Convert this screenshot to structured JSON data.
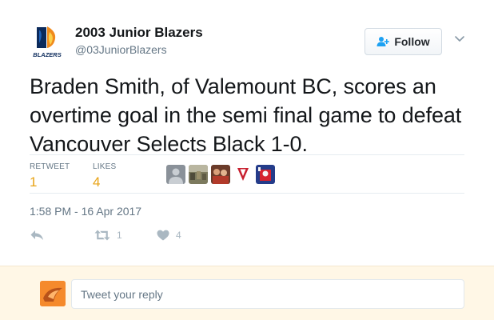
{
  "author": {
    "display_name": "2003 Junior Blazers",
    "handle": "@03JuniorBlazers",
    "logo_text": "BLAZERS"
  },
  "follow": {
    "label": "Follow"
  },
  "tweet": {
    "text": "Braden Smith, of Valemount BC, scores an overtime goal in the semi final game to defeat Vancouver Selects Black 1-0.",
    "timestamp": "1:58 PM - 16 Apr 2017"
  },
  "stats": {
    "retweet_label": "RETWEET",
    "retweet_count": "1",
    "likes_label": "LIKES",
    "likes_count": "4"
  },
  "actions": {
    "reply_icon": "reply-icon",
    "retweet_count": "1",
    "like_count": "4"
  },
  "reply": {
    "placeholder": "Tweet your reply"
  },
  "colors": {
    "stat_value": "#e8a316",
    "muted": "#657786",
    "reply_bar_bg": "#fff7e6"
  }
}
